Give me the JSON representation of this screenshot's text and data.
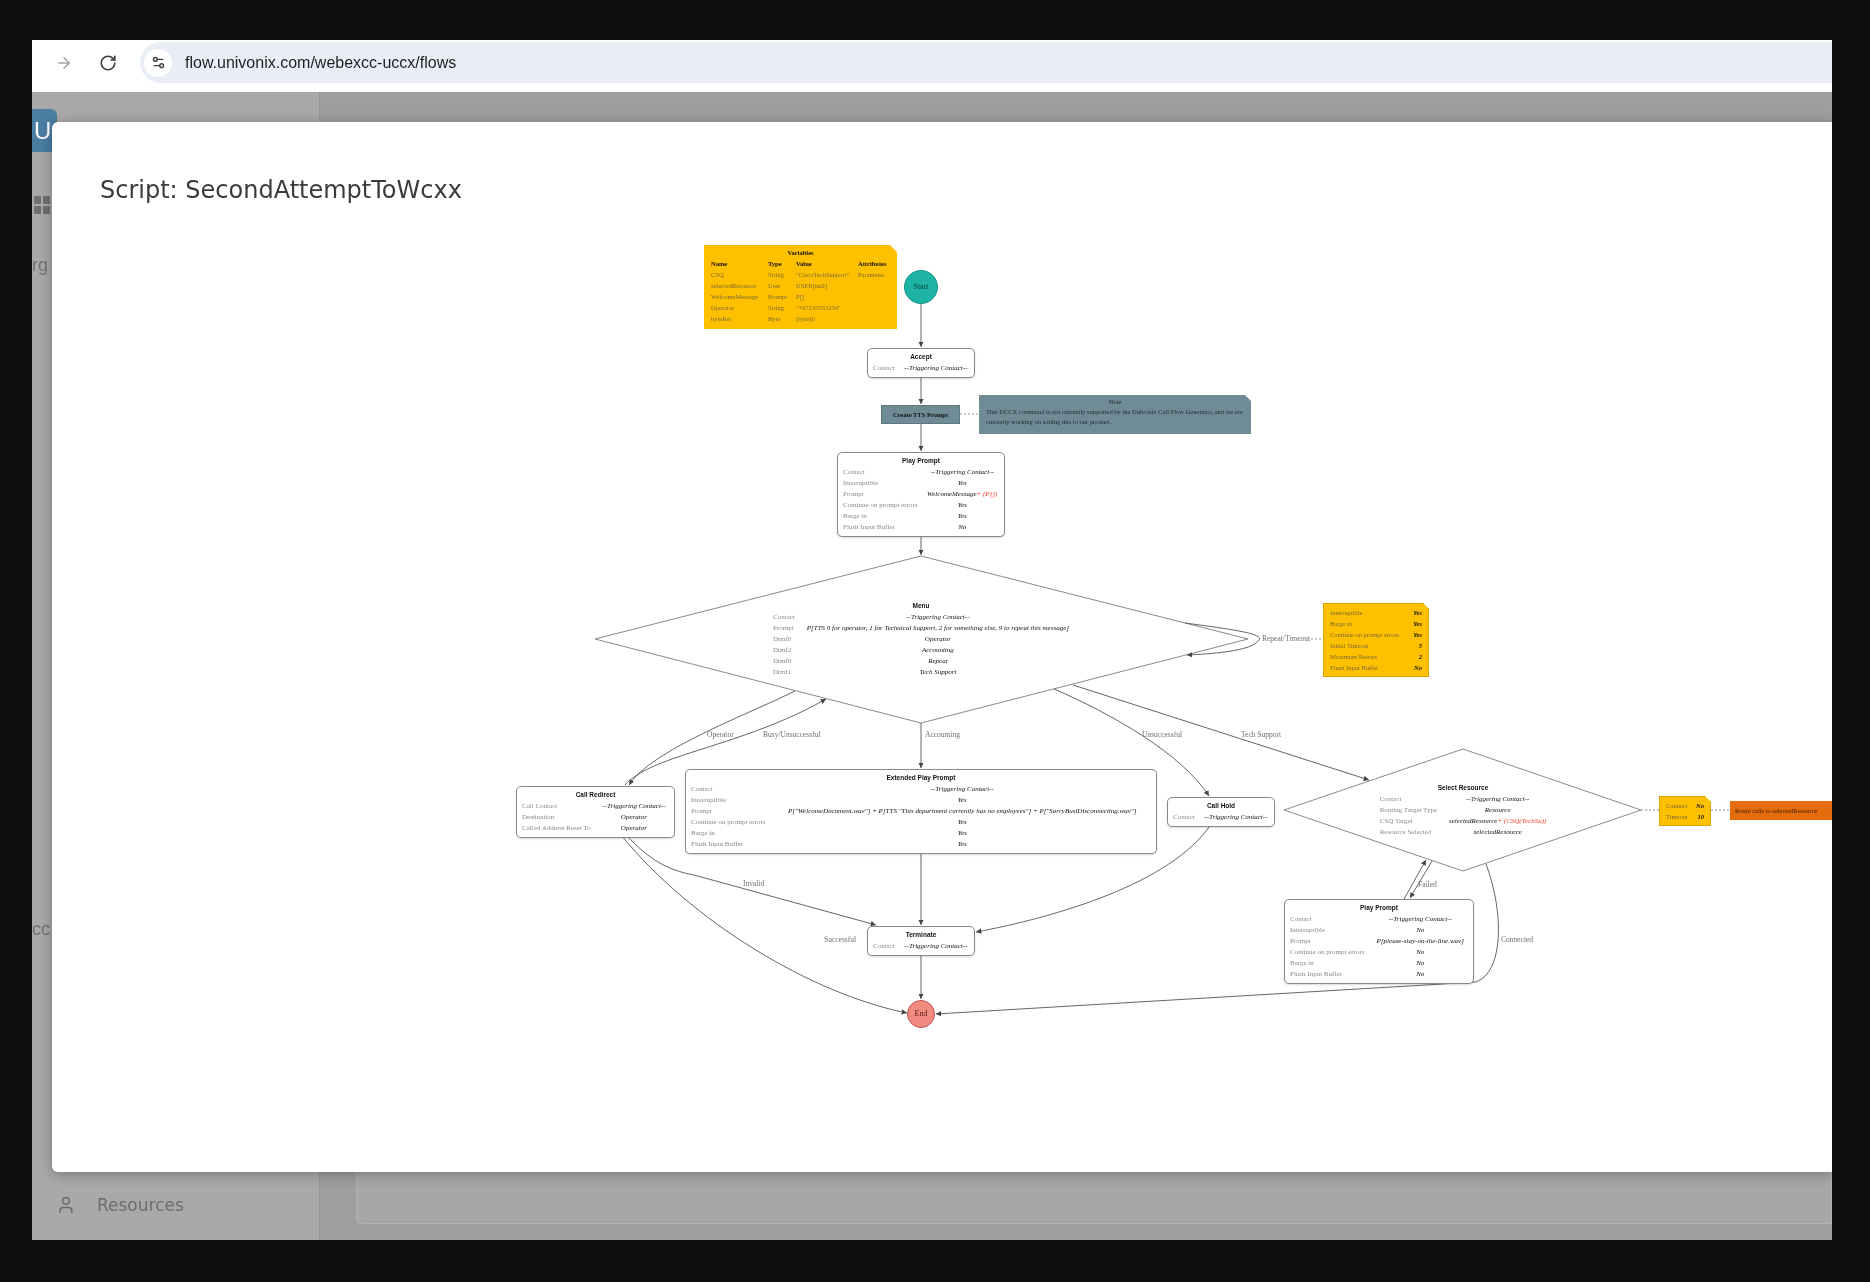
{
  "browser": {
    "url": "flow.univonix.com/webexcc-uccx/flows"
  },
  "app": {
    "logo_letter": "U",
    "sidebar": {
      "partial_labels": [
        "rg",
        "cc"
      ],
      "items": [
        {
          "label": "Resources"
        }
      ]
    }
  },
  "dialog": {
    "title": "Script: SecondAttemptToWcxx",
    "diagram": {
      "nodes": [
        {
          "kind": "variables",
          "title": "Variables",
          "columns": [
            "Name",
            "Type",
            "Value",
            "Attributes"
          ],
          "rows": [
            {
              "name": "CSQ",
              "type": "String",
              "value": "\"CiscoTechSupport\"",
              "attributes": "Parameter"
            },
            {
              "name": "selectedResource",
              "type": "User",
              "value": "USER[null]"
            },
            {
              "name": "WelcomeMessage",
              "type": "Prompt",
              "value": "P[]"
            },
            {
              "name": "Operator",
              "type": "String",
              "value": "\"+97235555234\""
            },
            {
              "name": "byteRet",
              "type": "Byte",
              "value": "(byte)0"
            }
          ]
        },
        {
          "kind": "start",
          "label": "Start"
        },
        {
          "kind": "step",
          "title": "Accept",
          "fields": [
            {
              "label": "Contact",
              "value": "--Triggering Contact--"
            }
          ]
        },
        {
          "kind": "command",
          "title": "Create TTS Prompt"
        },
        {
          "kind": "note",
          "title": "Note",
          "text": "This UCCX command is not currently supported by the Univonix Call Flow Generator, and we are currently working on adding this to our product."
        },
        {
          "kind": "step",
          "title": "Play Prompt",
          "fields": [
            {
              "label": "Contact",
              "value": "--Triggering Contact--"
            },
            {
              "label": "Interruptible",
              "value": "Yes"
            },
            {
              "label": "Prompt",
              "value": "WelcomeMessage",
              "error": "+ (P[])"
            },
            {
              "label": "Continue on prompt errors",
              "value": "Yes"
            },
            {
              "label": "Barge in",
              "value": "Yes"
            },
            {
              "label": "Flush Input Buffer",
              "value": "No"
            }
          ]
        },
        {
          "kind": "decision",
          "title": "Menu",
          "fields": [
            {
              "label": "Contact",
              "value": "--Triggering Contact--"
            },
            {
              "label": "Prompt",
              "value": "P[TTS 0 for operator, 1 for Technical Support, 2 for something else, 9 to repeat this message]"
            },
            {
              "label": "Dtmf0",
              "value": "Operator"
            },
            {
              "label": "Dtmf2",
              "value": "Accounting"
            },
            {
              "label": "Dtmf9",
              "value": "Repeat"
            },
            {
              "label": "Dtmf1",
              "value": "Tech Support"
            }
          ]
        },
        {
          "kind": "settings",
          "fields": [
            {
              "label": "Interruptible",
              "value": "Yes"
            },
            {
              "label": "Barge in",
              "value": "Yes"
            },
            {
              "label": "Continue on prompt errors",
              "value": "Yes"
            },
            {
              "label": "Initial Timeout",
              "value": "5"
            },
            {
              "label": "Maximum Retries",
              "value": "2"
            },
            {
              "label": "Flush Input Buffer",
              "value": "No"
            }
          ]
        },
        {
          "kind": "step",
          "title": "Call Redirect",
          "fields": [
            {
              "label": "Call Contact",
              "value": "--Triggering Contact--"
            },
            {
              "label": "Destination",
              "value": "Operator"
            },
            {
              "label": "Called Address Reset To",
              "value": "Operator"
            }
          ]
        },
        {
          "kind": "step",
          "title": "Extended Play Prompt",
          "fields": [
            {
              "label": "Contact",
              "value": "--Triggering Contact--"
            },
            {
              "label": "Interruptible",
              "value": "Yes"
            },
            {
              "label": "Prompt",
              "value": "P[\"WelcomeDocument.wav\"] + P[TTS \"This department currently has no employees\"] + P[\"SorryBusiDisconnecting.wav\"]"
            },
            {
              "label": "Continue on prompt errors",
              "value": "Yes"
            },
            {
              "label": "Barge in",
              "value": "Yes"
            },
            {
              "label": "Flush Input Buffer",
              "value": "Yes"
            }
          ]
        },
        {
          "kind": "step",
          "title": "Call Hold",
          "fields": [
            {
              "label": "Contact",
              "value": "--Triggering Contact--"
            }
          ]
        },
        {
          "kind": "decision",
          "title": "Select Resource",
          "fields": [
            {
              "label": "Contact",
              "value": "--Triggering Contact--"
            },
            {
              "label": "Routing Target Type",
              "value": "Resource"
            },
            {
              "label": "CSQ Target",
              "value": "selectedResource",
              "error": "+ (CSQ(TechSu))"
            },
            {
              "label": "Resource Selected",
              "value": "selectedResource"
            }
          ]
        },
        {
          "kind": "settings",
          "fields": [
            {
              "label": "Connect",
              "value": "No"
            },
            {
              "label": "Timeout",
              "value": "10"
            }
          ]
        },
        {
          "kind": "action",
          "text": "Route calls to selectedResource"
        },
        {
          "kind": "step",
          "title": "Terminate",
          "fields": [
            {
              "label": "Contact",
              "value": "--Triggering Contact--"
            }
          ]
        },
        {
          "kind": "step",
          "title": "Play Prompt",
          "fields": [
            {
              "label": "Contact",
              "value": "--Triggering Contact--"
            },
            {
              "label": "Interruptible",
              "value": "No"
            },
            {
              "label": "Prompt",
              "value": "P[please-stay-on-the-line.wav]"
            },
            {
              "label": "Continue on prompt errors",
              "value": "No"
            },
            {
              "label": "Barge in",
              "value": "No"
            },
            {
              "label": "Flush Input Buffer",
              "value": "No"
            }
          ]
        },
        {
          "kind": "end",
          "label": "End"
        }
      ],
      "edge_labels": [
        "Repeat/Timeout",
        "Operator",
        "Busy/Unsuccessful",
        "Accounting",
        "Unsuccessful",
        "Tech Support",
        "Invalid",
        "Successful",
        "Failed",
        "Connected"
      ]
    }
  }
}
